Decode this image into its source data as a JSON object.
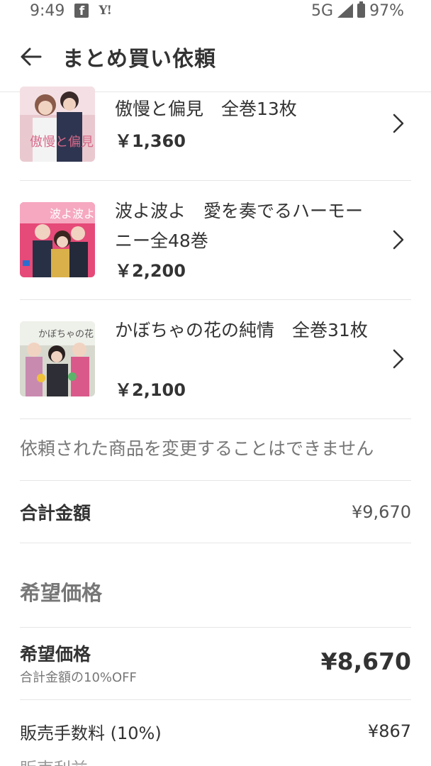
{
  "status_bar": {
    "time": "9:49",
    "fb_glyph": "f",
    "yahoo_glyph": "Y!",
    "network": "5G",
    "battery": "97%"
  },
  "header": {
    "title": "まとめ買い依頼"
  },
  "items": [
    {
      "title": "傲慢と偏見　全巻13枚",
      "price": "￥1,360"
    },
    {
      "title": "波よ波よ　愛を奏でるハーモーニー全48巻",
      "price": "￥2,200"
    },
    {
      "title": "かぼちゃの花の純情　全巻31枚",
      "price": "￥2,100"
    }
  ],
  "notice": "依頼された商品を変更することはできません",
  "total": {
    "label": "合計金額",
    "value": "¥9,670"
  },
  "section_heading": "希望価格",
  "desired": {
    "label": "希望価格",
    "sub": "合計金額の10%OFF",
    "value": "¥8,670"
  },
  "fee": {
    "label": "販売手数料 (10%)",
    "value": "¥867"
  },
  "cutoff_text": "販売利益"
}
